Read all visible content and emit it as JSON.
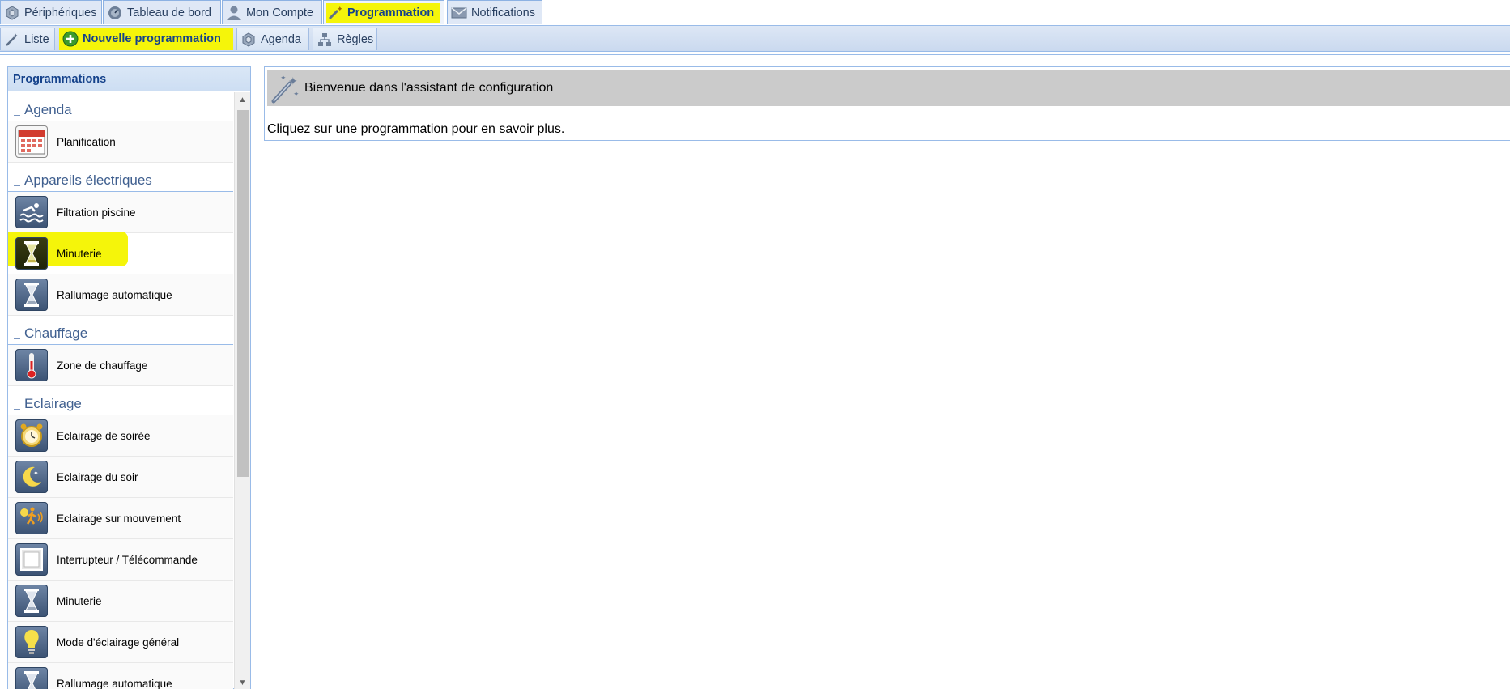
{
  "top_tabs": [
    {
      "label": "Périphériques",
      "icon": "gear-cube-icon"
    },
    {
      "label": "Tableau de bord",
      "icon": "gauge-icon"
    },
    {
      "label": "Mon Compte",
      "icon": "user-icon"
    },
    {
      "label": "Programmation",
      "icon": "magic-wand-icon",
      "active": true
    },
    {
      "label": "Notifications",
      "icon": "envelope-icon"
    }
  ],
  "sub_tabs": [
    {
      "label": "Liste",
      "icon": "magic-wand-icon"
    },
    {
      "label": "Nouvelle programmation",
      "icon": "plus-circle-icon",
      "active": true
    },
    {
      "label": "Agenda",
      "icon": "gear-cube-icon"
    },
    {
      "label": "Règles",
      "icon": "hierarchy-icon"
    }
  ],
  "left_panel": {
    "title": "Programmations",
    "groups": [
      {
        "title": "Agenda",
        "items": [
          {
            "label": "Planification",
            "icon": "calendar-icon"
          }
        ]
      },
      {
        "title": "Appareils électriques",
        "items": [
          {
            "label": "Filtration piscine",
            "icon": "swimming-icon"
          },
          {
            "label": "Minuterie",
            "icon": "hourglass-icon"
          },
          {
            "label": "Rallumage automatique",
            "icon": "hourglass-icon"
          }
        ]
      },
      {
        "title": "Chauffage",
        "items": [
          {
            "label": "Zone de chauffage",
            "icon": "thermometer-icon"
          }
        ]
      },
      {
        "title": "Eclairage",
        "items": [
          {
            "label": "Eclairage de soirée",
            "icon": "alarm-clock-icon"
          },
          {
            "label": "Eclairage du soir",
            "icon": "moon-icon"
          },
          {
            "label": "Eclairage sur mouvement",
            "icon": "motion-sensor-icon"
          },
          {
            "label": "Interrupteur / Télécommande",
            "icon": "switch-icon"
          },
          {
            "label": "Minuterie",
            "icon": "hourglass-icon"
          },
          {
            "label": "Mode d'éclairage général",
            "icon": "light-bulb-icon"
          },
          {
            "label": "Rallumage automatique",
            "icon": "hourglass-icon"
          }
        ]
      }
    ]
  },
  "main": {
    "title": "Bienvenue dans l'assistant de configuration",
    "text": "Cliquez sur une programmation pour en savoir plus."
  },
  "colors": {
    "highlight": "#f5f50a",
    "border": "#99bbe8",
    "header_text": "#15428b"
  }
}
